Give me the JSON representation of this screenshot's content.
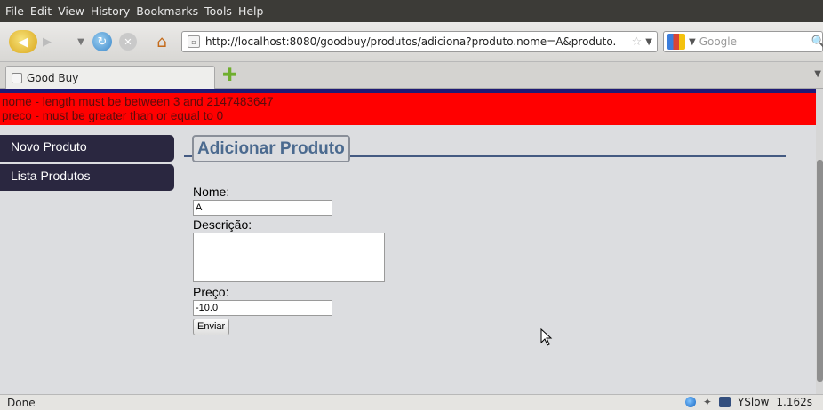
{
  "menu": {
    "items": [
      "File",
      "Edit",
      "View",
      "History",
      "Bookmarks",
      "Tools",
      "Help"
    ]
  },
  "nav": {
    "url": "http://localhost:8080/goodbuy/produtos/adiciona?produto.nome=A&produto.",
    "search_placeholder": "Google"
  },
  "tab": {
    "title": "Good Buy"
  },
  "errors": [
    "nome - length must be between 3 and 2147483647",
    "preco - must be greater than or equal to 0"
  ],
  "sidebar": {
    "items": [
      {
        "label": "Novo Produto"
      },
      {
        "label": "Lista Produtos"
      }
    ]
  },
  "form": {
    "legend": "Adicionar Produto",
    "nome_label": "Nome:",
    "nome_value": "A",
    "descricao_label": "Descrição:",
    "descricao_value": "",
    "preco_label": "Preço:",
    "preco_value": "-10.0",
    "submit_label": "Enviar"
  },
  "status": {
    "text": "Done",
    "yslow_label": "YSlow",
    "load_time": "1.162s"
  },
  "colors": {
    "error_bg": "#ff0000",
    "top_band": "#1f1b75",
    "sidebar_bg": "#2a2740",
    "legend_text": "#4b6a8f"
  }
}
